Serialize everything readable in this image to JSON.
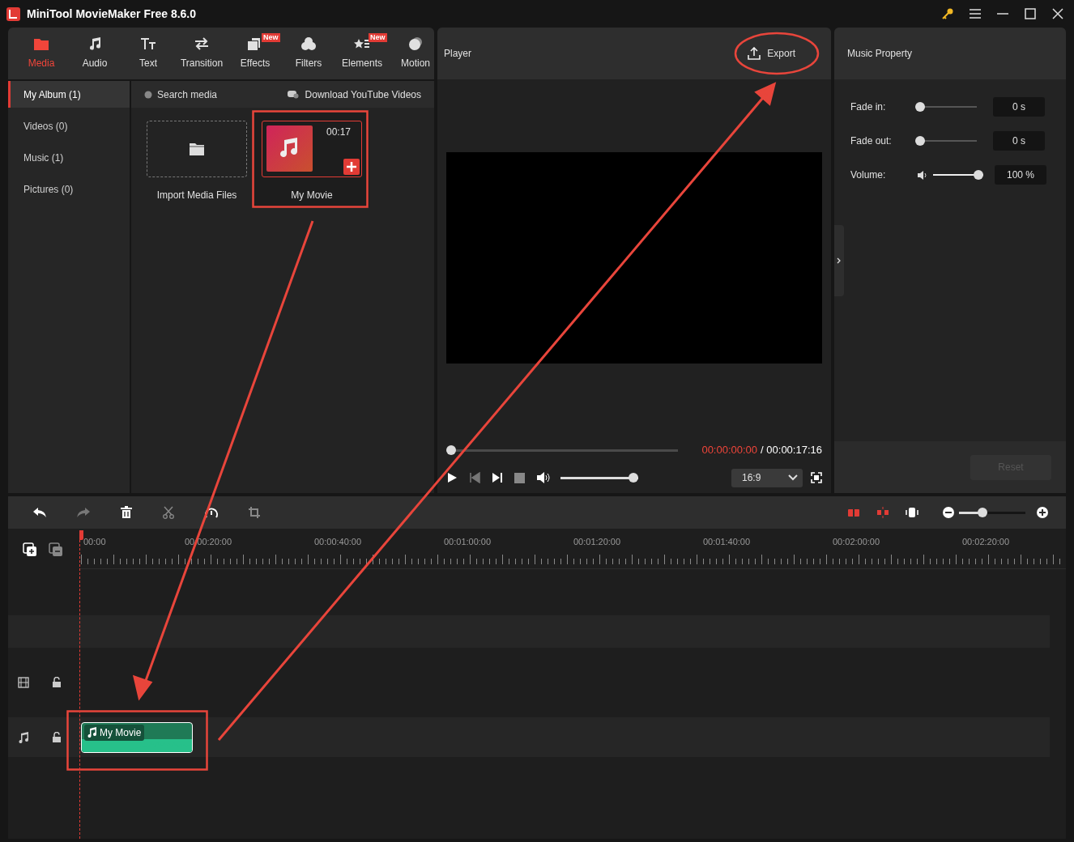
{
  "window": {
    "title": "MiniTool MovieMaker Free 8.6.0"
  },
  "toolbar_tabs": [
    {
      "label": "Media",
      "selected": true
    },
    {
      "label": "Audio",
      "selected": false
    },
    {
      "label": "Text",
      "selected": false
    },
    {
      "label": "Transition",
      "selected": false
    },
    {
      "label": "Effects",
      "selected": false,
      "badge": "New"
    },
    {
      "label": "Filters",
      "selected": false
    },
    {
      "label": "Elements",
      "selected": false,
      "badge": "New"
    },
    {
      "label": "Motion",
      "selected": false
    }
  ],
  "library_nav": [
    {
      "label": "My Album (1)",
      "selected": true
    },
    {
      "label": "Videos (0)",
      "selected": false
    },
    {
      "label": "Music (1)",
      "selected": false
    },
    {
      "label": "Pictures (0)",
      "selected": false
    }
  ],
  "media_bar": {
    "search_placeholder": "Search media",
    "download_link": "Download YouTube Videos"
  },
  "media_items": [
    {
      "kind": "import",
      "label": "Import Media Files"
    },
    {
      "kind": "clip",
      "label": "My Movie",
      "duration": "00:17"
    }
  ],
  "player": {
    "title": "Player",
    "export": "Export",
    "current_time": "00:00:00:00",
    "total_time": "/ 00:00:17:16",
    "progress": {
      "level": 0
    },
    "volume": {
      "level": 1
    },
    "aspect": "16:9"
  },
  "music_property": {
    "title": "Music Property",
    "rows": [
      {
        "kind": "fade",
        "label": "Fade in:",
        "level": 0,
        "value": "0 s"
      },
      {
        "kind": "fade",
        "label": "Fade out:",
        "level": 0,
        "value": "0 s"
      },
      {
        "kind": "volume",
        "label": "Volume:",
        "level": 1,
        "value": "100 %"
      }
    ],
    "reset": {
      "label": "Reset",
      "disabled": true
    }
  },
  "timeline": {
    "zoom": {
      "level": 0.35
    },
    "ruler_labels": [
      "00:00",
      "00:00:20:00",
      "00:00:40:00",
      "00:01:00:00",
      "00:01:20:00",
      "00:01:40:00",
      "00:02:00:00",
      "00:02:20:00"
    ],
    "audio_clip": {
      "label": "My Movie"
    }
  }
}
